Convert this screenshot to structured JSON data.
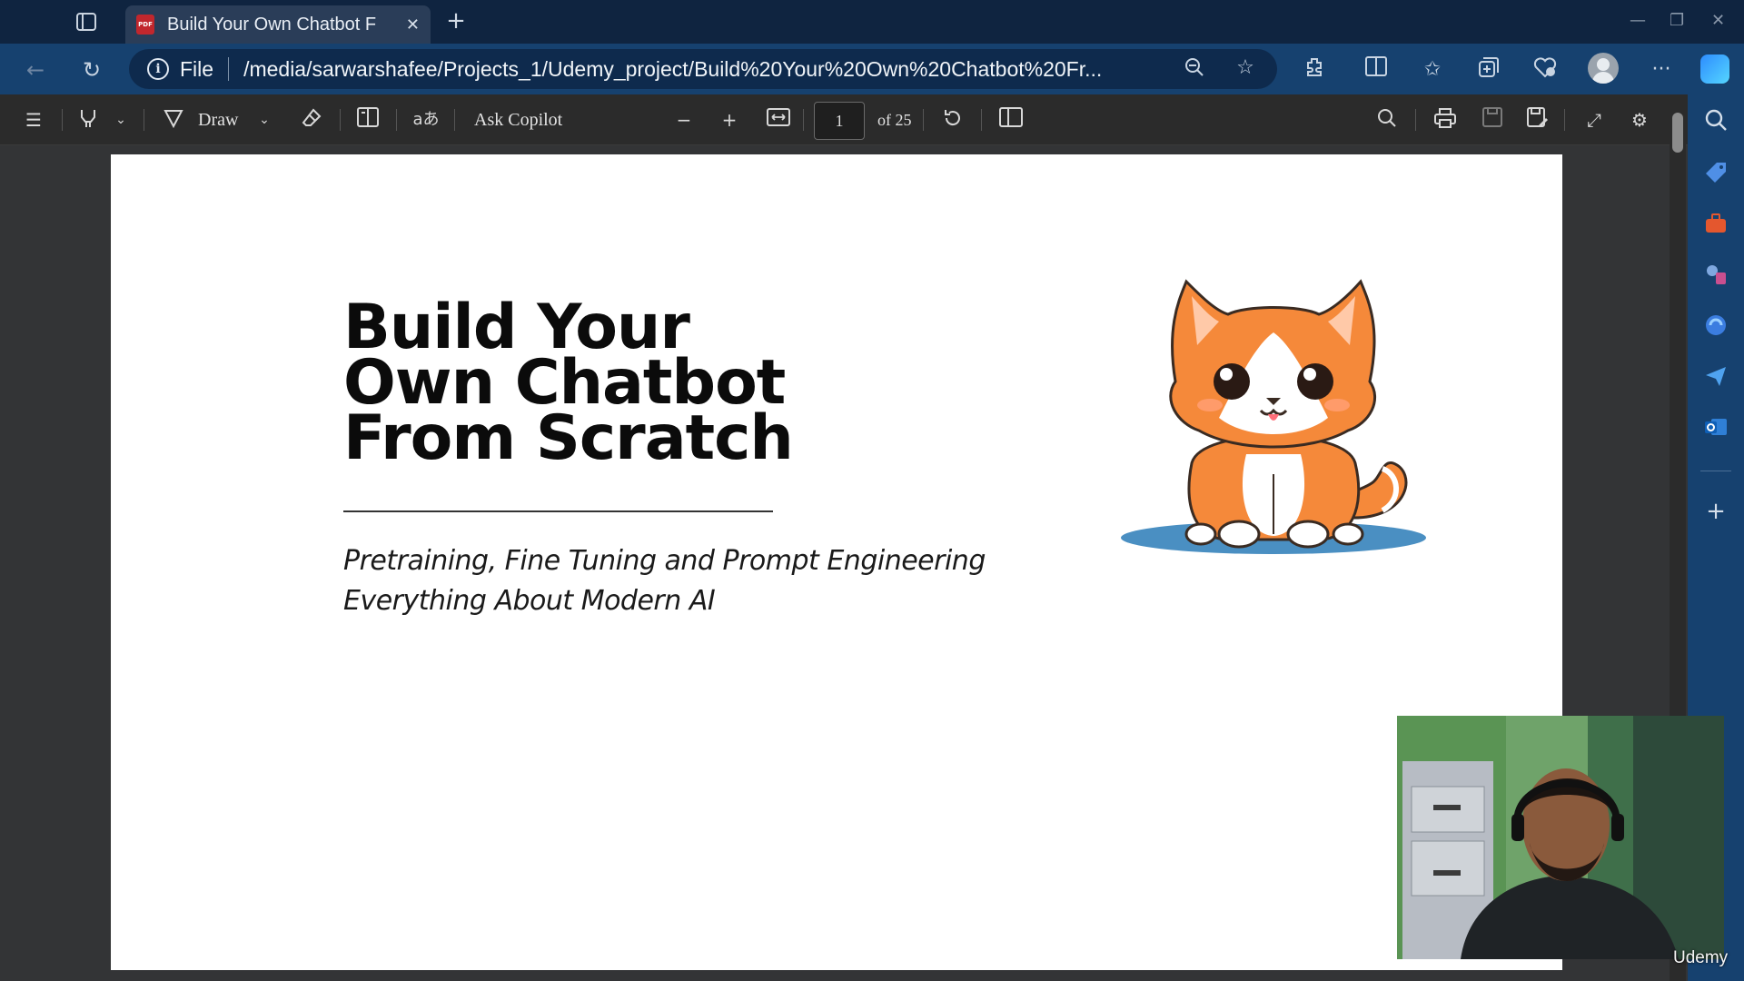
{
  "browser": {
    "tab": {
      "title": "Build Your Own Chatbot F",
      "icon": "pdf-icon"
    },
    "address": {
      "scheme_label": "File",
      "url": "/media/sarwarshafee/Projects_1/Udemy_project/Build%20Your%20Own%20Chatbot%20Fr..."
    }
  },
  "pdf_toolbar": {
    "draw_label": "Draw",
    "ask_copilot_label": "Ask Copilot",
    "page_number": "1",
    "page_total_label": "of 25"
  },
  "document": {
    "title_lines": [
      "Build Your",
      "Own Chatbot",
      "From Scratch"
    ],
    "subtitle_lines": [
      "Pretraining, Fine Tuning and Prompt Engineering",
      "Everything About Modern AI"
    ]
  },
  "watermark": "Udemy",
  "colors": {
    "tabbar_bg": "#0f2440",
    "navbar_bg": "#16416f",
    "pdf_toolbar_bg": "#2b2b2b",
    "page_bg": "#ffffff",
    "cat_orange": "#f5893a"
  }
}
